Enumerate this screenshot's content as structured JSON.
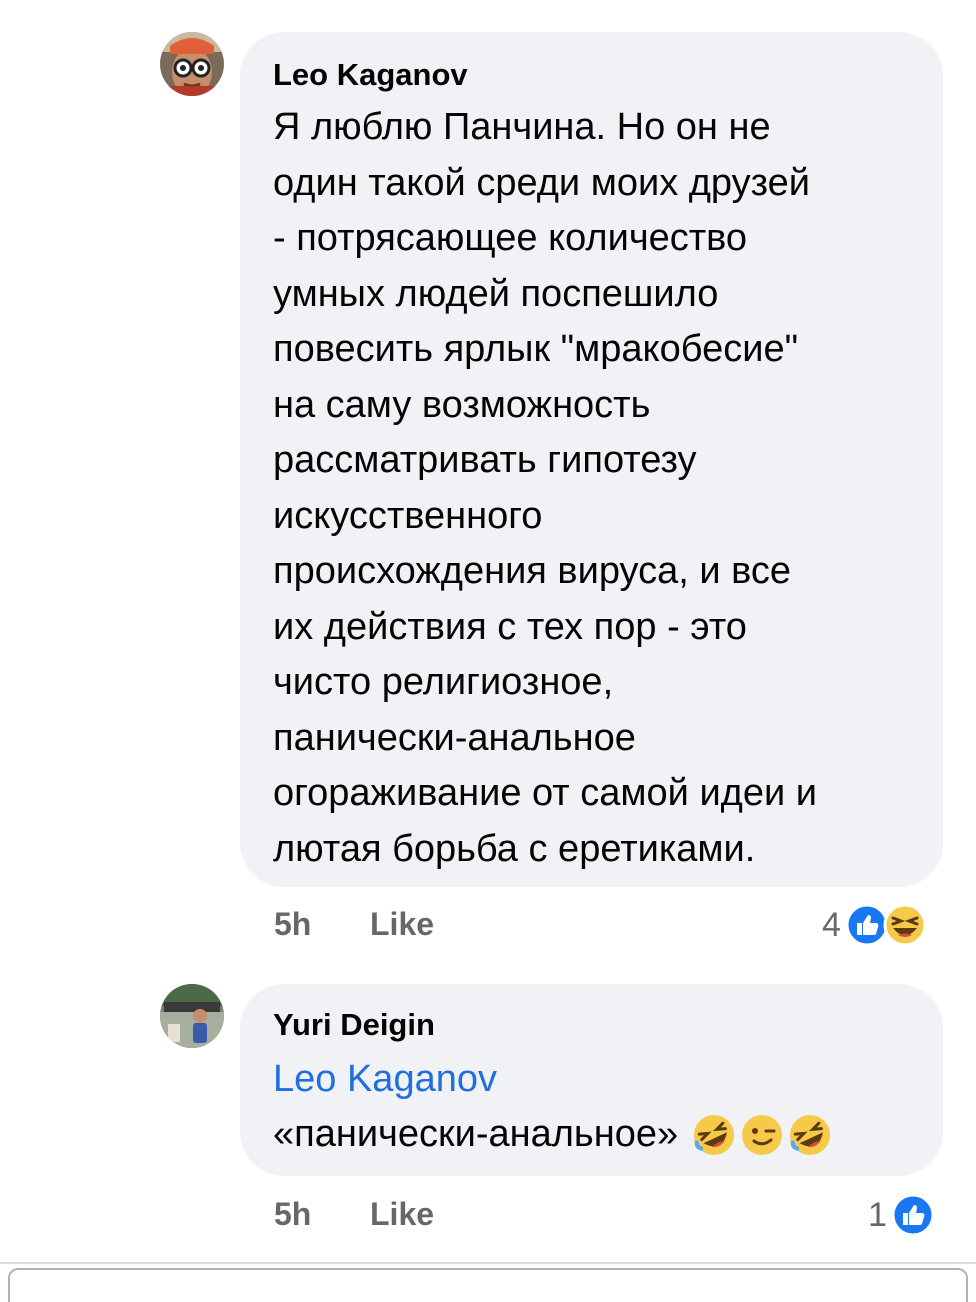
{
  "comments": [
    {
      "author": "Leo Kaganov",
      "text": "Я люблю Панчина. Но он не\nодин такой среди моих друзей\n- потрясающее количество\nумных людей поспешило\nповесить ярлык  \"мракобесие\"\nна саму возможность\nрассматривать гипотезу\nискусственного\nпроисхождения вируса, и все\nих действия с тех пор - это\nчисто религиозное,\nпанически-анальное\nогораживание от самой идеи и\nлютая борьба с еретиками.",
      "time": "5h",
      "like_label": "Like",
      "reaction_count": "4",
      "reaction_icons": [
        "like-icon",
        "laughing-emoji-icon"
      ]
    },
    {
      "author": "Yuri Deigin",
      "mention": "Leo Kaganov",
      "text": "«панически-анальное»",
      "inline_emojis": [
        "rofl-emoji-icon",
        "wink-emoji-icon",
        "rofl-emoji-icon"
      ],
      "time": "5h",
      "like_label": "Like",
      "reaction_count": "1",
      "reaction_icons": [
        "like-icon"
      ]
    }
  ],
  "colors": {
    "bubble": "#f0f2f5",
    "text": "#050505",
    "meta": "#65676b",
    "mention": "#216fdb",
    "like_blue": "#1877f2",
    "emoji_yellow": "#f7c948"
  }
}
